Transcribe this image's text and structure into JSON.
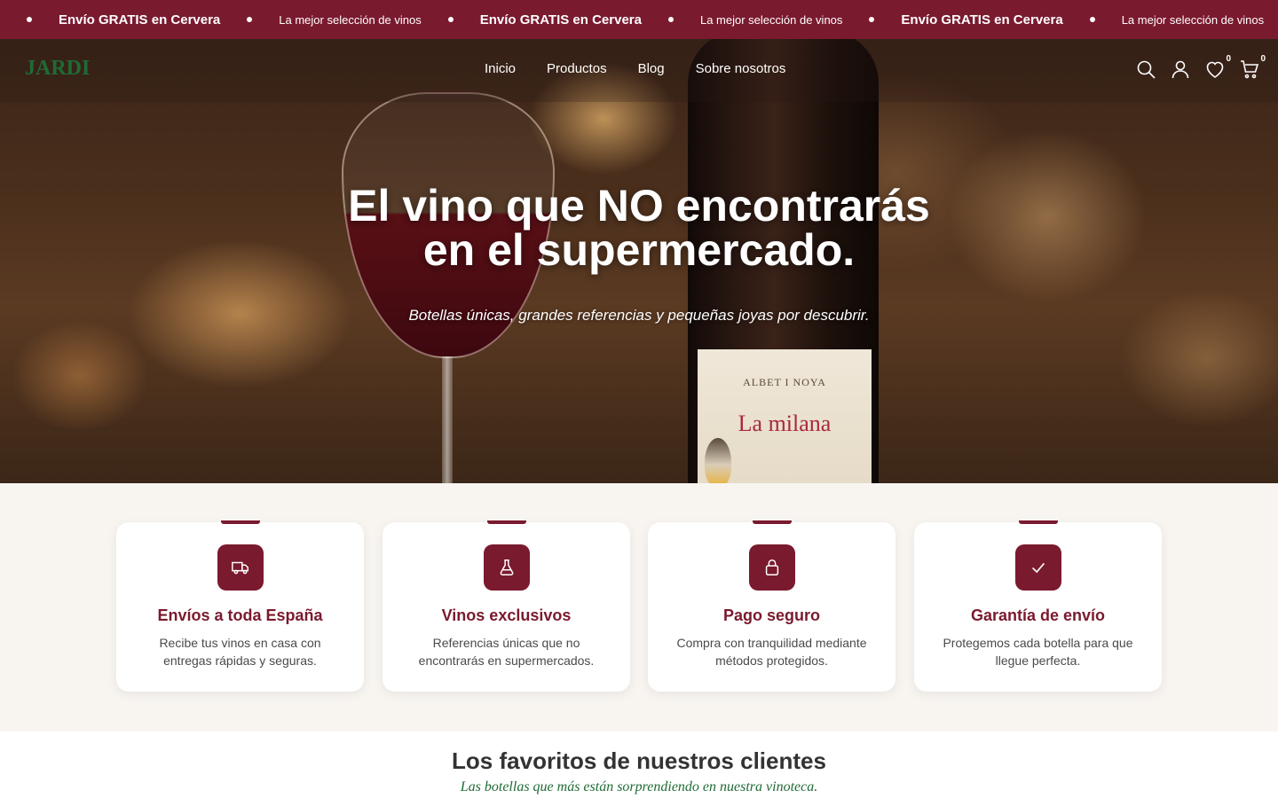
{
  "announcement": {
    "items": [
      {
        "text": "Envío GRATIS en Cervera",
        "style": "bold"
      },
      {
        "text": "La mejor selección de vinos",
        "style": "light"
      },
      {
        "text": "Envío GRATIS en Cervera",
        "style": "bold"
      },
      {
        "text": "La mejor selección de vinos",
        "style": "light"
      },
      {
        "text": "Envío GRATIS en Cervera",
        "style": "bold"
      },
      {
        "text": "La mejor selección de vinos",
        "style": "light"
      }
    ]
  },
  "header": {
    "logo": "JARDI",
    "nav": [
      "Inicio",
      "Productos",
      "Blog",
      "Sobre nosotros"
    ],
    "icons": {
      "search": "search-icon",
      "account": "user-icon",
      "wishlist": "heart-icon",
      "cart": "cart-icon"
    },
    "wishlist_count": "0",
    "cart_count": "0"
  },
  "hero": {
    "title_line1": "El vino que NO encontrarás",
    "title_line2": "en el supermercado.",
    "subtitle": "Botellas únicas, grandes referencias y pequeñas joyas por descubrir.",
    "bottle_brand": "ALBET I NOYA",
    "bottle_name": "La milana"
  },
  "features": [
    {
      "icon": "truck-icon",
      "title": "Envíos a toda España",
      "text": "Recibe tus vinos en casa con entregas rápidas y seguras."
    },
    {
      "icon": "flask-icon",
      "title": "Vinos exclusivos",
      "text": "Referencias únicas que no encontrarás en supermercados."
    },
    {
      "icon": "lock-icon",
      "title": "Pago seguro",
      "text": "Compra con tranquilidad mediante métodos protegidos."
    },
    {
      "icon": "check-icon",
      "title": "Garantía de envío",
      "text": "Protegemos cada botella para que llegue perfecta."
    }
  ],
  "favorites": {
    "title": "Los favoritos de nuestros clientes",
    "subtitle": "Las botellas que más están sorprendiendo en nuestra vinoteca."
  },
  "colors": {
    "brand": "#7a1a2e",
    "logo": "#1f6b35",
    "features_bg": "#f8f5f1"
  }
}
